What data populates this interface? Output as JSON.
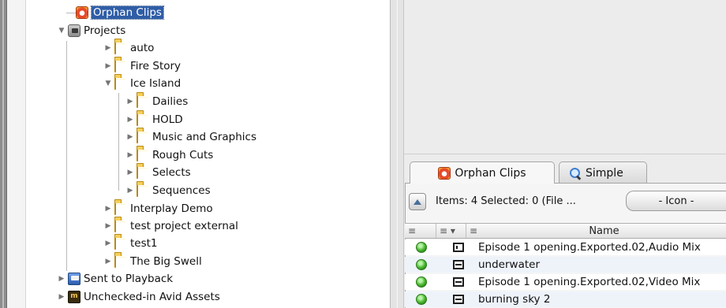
{
  "tree": {
    "items": [
      {
        "label": "Orphan Clips",
        "icon": "orphan-clips-icon",
        "selected": true
      },
      {
        "label": "Projects",
        "icon": "projects-icon",
        "expanded": true
      },
      {
        "label": "auto",
        "icon": "folder-icon"
      },
      {
        "label": "Fire Story",
        "icon": "folder-icon"
      },
      {
        "label": "Ice Island",
        "icon": "folder-icon",
        "expanded": true
      },
      {
        "label": "Dailies",
        "icon": "folder-icon"
      },
      {
        "label": "HOLD",
        "icon": "folder-icon"
      },
      {
        "label": "Music and Graphics",
        "icon": "folder-icon"
      },
      {
        "label": "Rough Cuts",
        "icon": "folder-icon"
      },
      {
        "label": "Selects",
        "icon": "folder-icon"
      },
      {
        "label": "Sequences",
        "icon": "folder-icon"
      },
      {
        "label": "Interplay Demo",
        "icon": "folder-icon"
      },
      {
        "label": "test project external",
        "icon": "folder-icon"
      },
      {
        "label": "test1",
        "icon": "folder-icon"
      },
      {
        "label": "The Big Swell",
        "icon": "folder-icon"
      },
      {
        "label": "Sent to Playback",
        "icon": "playback-icon"
      },
      {
        "label": "Unchecked-in Avid Assets",
        "icon": "avid-assets-icon"
      }
    ]
  },
  "tabs": [
    {
      "label": "Orphan Clips",
      "icon": "orphan-clips-icon",
      "active": true
    },
    {
      "label": "Simple",
      "icon": "search-icon",
      "active": false
    }
  ],
  "toolbar": {
    "items_text": "Items: 4 Selected: 0 (File ...",
    "view_mode": "- Icon -"
  },
  "columns": {
    "status": "≡",
    "type": "≡ ▾",
    "name_marker": "≡",
    "name": "Name"
  },
  "bin_rows": [
    {
      "name": "Episode 1 opening.Exported.02,Audio Mix",
      "type": "sequence-icon",
      "status": "online"
    },
    {
      "name": "underwater",
      "type": "clip-icon",
      "status": "online"
    },
    {
      "name": "Episode 1 opening.Exported.02,Video Mix",
      "type": "clip-icon",
      "status": "online"
    },
    {
      "name": "burning sky 2",
      "type": "clip-icon",
      "status": "online"
    }
  ],
  "colors": {
    "selection": "#2f5da6",
    "status_online": "#3fae2a",
    "folder": "#f6cf5a"
  }
}
